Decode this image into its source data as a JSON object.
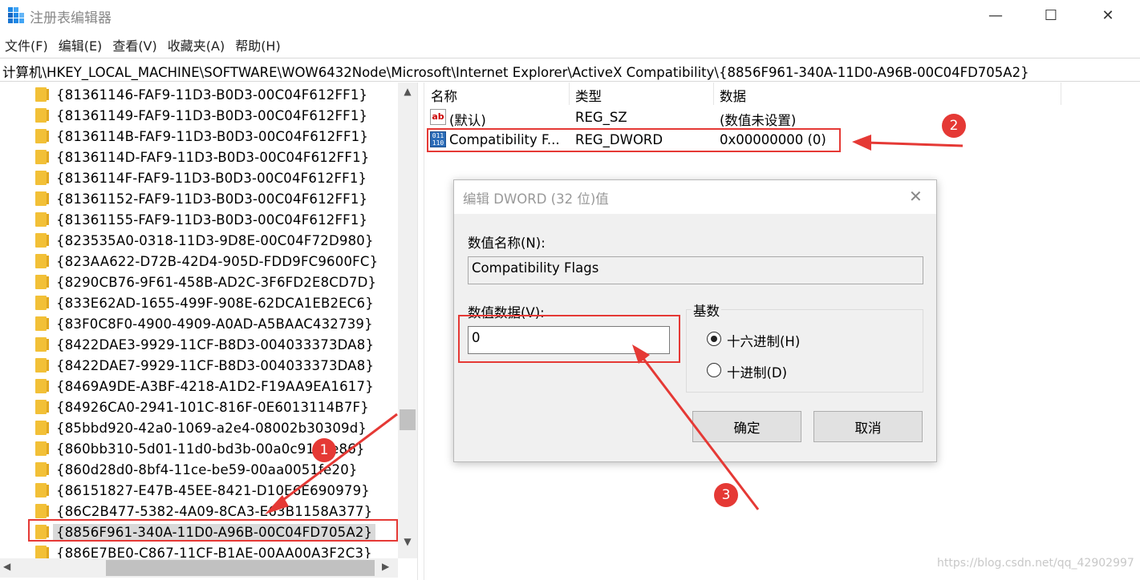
{
  "window": {
    "title": "注册表编辑器",
    "min_glyph": "—",
    "max_glyph": "☐",
    "close_glyph": "✕"
  },
  "menu": [
    "文件(F)",
    "编辑(E)",
    "查看(V)",
    "收藏夹(A)",
    "帮助(H)"
  ],
  "address": "计算机\\HKEY_LOCAL_MACHINE\\SOFTWARE\\WOW6432Node\\Microsoft\\Internet Explorer\\ActiveX Compatibility\\{8856F961-340A-11D0-A96B-00C04FD705A2}",
  "tree": {
    "items": [
      "{81361146-FAF9-11D3-B0D3-00C04F612FF1}",
      "{81361149-FAF9-11D3-B0D3-00C04F612FF1}",
      "{8136114B-FAF9-11D3-B0D3-00C04F612FF1}",
      "{8136114D-FAF9-11D3-B0D3-00C04F612FF1}",
      "{8136114F-FAF9-11D3-B0D3-00C04F612FF1}",
      "{81361152-FAF9-11D3-B0D3-00C04F612FF1}",
      "{81361155-FAF9-11D3-B0D3-00C04F612FF1}",
      "{823535A0-0318-11D3-9D8E-00C04F72D980}",
      "{823AA622-D72B-42D4-905D-FDD9FC9600FC}",
      "{8290CB76-9F61-458B-AD2C-3F6FD2E8CD7D}",
      "{833E62AD-1655-499F-908E-62DCA1EB2EC6}",
      "{83F0C8F0-4900-4909-A0AD-A5BAAC432739}",
      "{8422DAE3-9929-11CF-B8D3-004033373DA8}",
      "{8422DAE7-9929-11CF-B8D3-004033373DA8}",
      "{8469A9DE-A3BF-4218-A1D2-F19AA9EA1617}",
      "{84926CA0-2941-101C-816F-0E6013114B7F}",
      "{85bbd920-42a0-1069-a2e4-08002b30309d}",
      "{860bb310-5d01-11d0-bd3b-00a0c911ce86}",
      "{860d28d0-8bf4-11ce-be59-00aa0051fe20}",
      "{86151827-E47B-45EE-8421-D10E6E690979}",
      "{86C2B477-5382-4A09-8CA3-E63B1158A377}",
      "{8856F961-340A-11D0-A96B-00C04FD705A2}",
      "{886E7BE0-C867-11CF-B1AE-00AA00A3F2C3}"
    ],
    "selected_index": 21
  },
  "list": {
    "headers": {
      "name": "名称",
      "type": "类型",
      "data": "数据"
    },
    "rows": [
      {
        "icon": "string-value-icon",
        "name": "(默认)",
        "type": "REG_SZ",
        "data": "(数值未设置)"
      },
      {
        "icon": "dword-value-icon",
        "name": "Compatibility F...",
        "type": "REG_DWORD",
        "data": "0x00000000 (0)"
      }
    ]
  },
  "dialog": {
    "title": "编辑 DWORD (32 位)值",
    "name_label": "数值名称(N):",
    "name_value": "Compatibility Flags",
    "data_label": "数值数据(V):",
    "data_value": "0",
    "base_label": "基数",
    "radio_hex": "十六进制(H)",
    "radio_dec": "十进制(D)",
    "selected_base": "hex",
    "ok": "确定",
    "cancel": "取消",
    "close_glyph": "✕"
  },
  "annotations": {
    "badge1": "1",
    "badge2": "2",
    "badge3": "3",
    "color": "#e53935"
  },
  "watermark": "https://blog.csdn.net/qq_42902997"
}
